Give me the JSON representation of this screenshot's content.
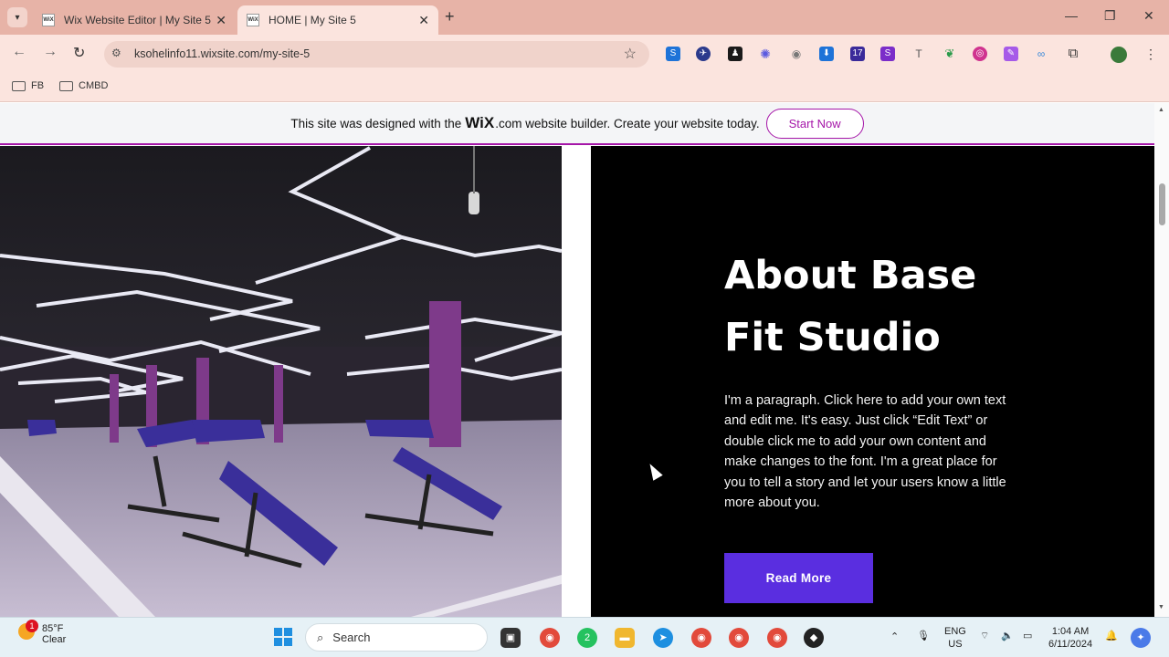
{
  "browser": {
    "tabs": [
      {
        "title": "Wix Website Editor | My Site 5",
        "favicon": "WiX",
        "active": false
      },
      {
        "title": "HOME | My Site 5",
        "favicon": "WiX",
        "active": true
      }
    ],
    "address": "ksohelinfo11.wixsite.com/my-site-5",
    "bookmarks": [
      "FB",
      "CMBD"
    ],
    "extension_badge": "17"
  },
  "banner": {
    "text_before": "This site was designed with the",
    "wix_logo": "WiX",
    "text_after": ".com website builder. Create your website today.",
    "cta": "Start Now"
  },
  "about": {
    "title_line1": "About Base",
    "title_line2": "Fit Studio",
    "paragraph": "I'm a paragraph. Click here to add your own text and edit me. It's easy. Just click “Edit Text” or double click me to add your own content and make changes to the font. I'm a great place for you to tell a story and let your users know a little more about you.",
    "button": "Read More"
  },
  "taskbar": {
    "weather_temp": "85°F",
    "weather_desc": "Clear",
    "weather_badge": "1",
    "search_placeholder": "Search",
    "whatsapp_badge": "2",
    "lang_top": "ENG",
    "lang_bottom": "US",
    "time": "1:04 AM",
    "date": "6/11/2024"
  },
  "colors": {
    "accent": "#a516a8",
    "button": "#5a2ee0",
    "chrome": "#e7b3a7"
  }
}
